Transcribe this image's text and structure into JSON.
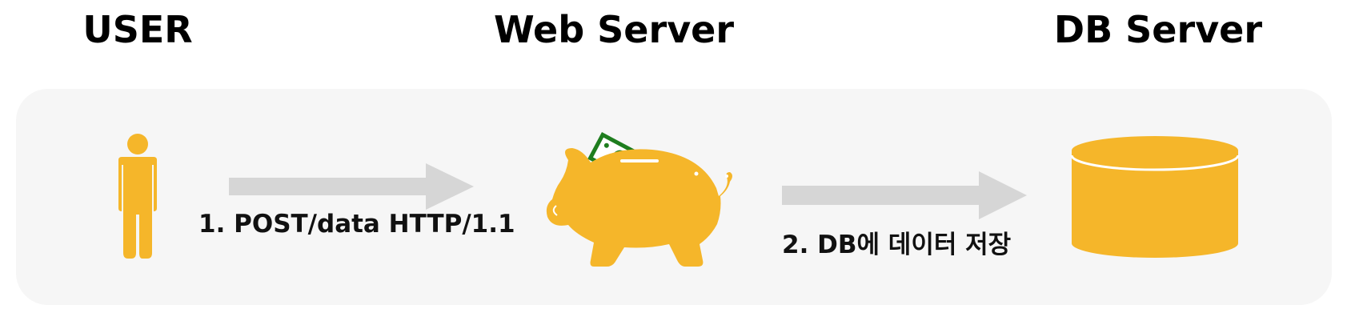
{
  "headings": {
    "user": "USER",
    "web_server": "Web Server",
    "db_server": "DB Server"
  },
  "steps": [
    {
      "label": "1. POST/data HTTP/1.1"
    },
    {
      "label": "2. DB에 데이터 저장"
    }
  ],
  "icons": {
    "user": "person-icon",
    "web_server": "piggy-bank-icon",
    "db_server": "database-cylinder-icon",
    "money": "banknote-icon",
    "arrow": "right-arrow-icon"
  },
  "colors": {
    "accent": "#F5B62A",
    "arrow": "#D6D6D6",
    "panel": "#F6F6F6",
    "money": "#1E7D1E"
  }
}
